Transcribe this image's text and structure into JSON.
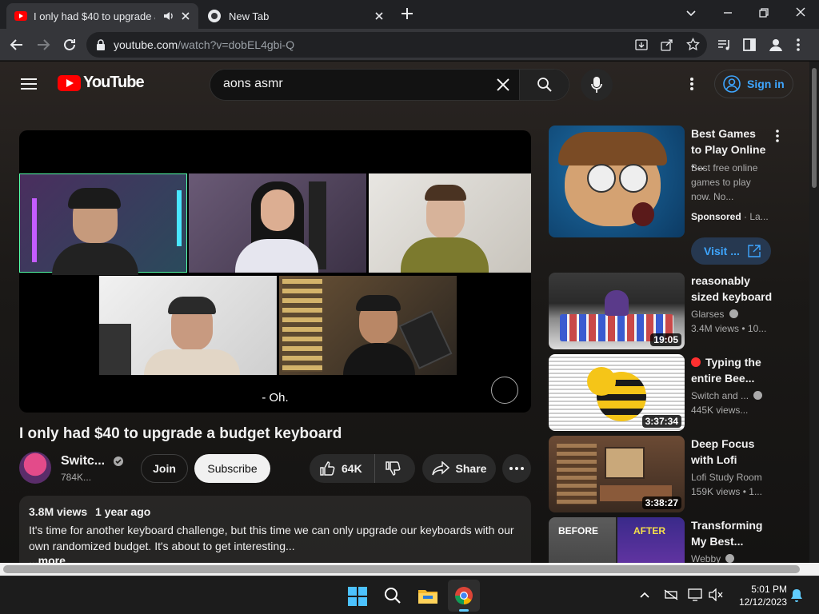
{
  "browser": {
    "tabs": [
      {
        "title": "I only had $40 to upgrade a",
        "active": true
      },
      {
        "title": "New Tab",
        "active": false
      }
    ],
    "url_host": "youtube.com",
    "url_path": "/watch?v=dobEL4gbi-Q"
  },
  "youtube": {
    "logo_text": "YouTube",
    "search_value": "aons asmr",
    "signin_label": "Sign in",
    "video": {
      "caption": "- Oh.",
      "title": "I only had $40 to upgrade a budget keyboard",
      "channel_name": "Switc...",
      "subscribers": "784K...",
      "join_label": "Join",
      "subscribe_label": "Subscribe",
      "likes": "64K",
      "share_label": "Share"
    },
    "description": {
      "views": "3.8M views",
      "age": "1 year ago",
      "text_line1": "It's time for another keyboard challenge, but this time we can only upgrade our keyboards with our",
      "text_line2": "own randomized budget. It's about to get interesting...",
      "more_label": "...more"
    },
    "sidebar": [
      {
        "title": "Best Games to Play Online -...",
        "meta1": "Best free online games to play now. No...",
        "sponsored": "Sponsored",
        "advertiser": "La...",
        "visit_label": "Visit ..."
      },
      {
        "title": "reasonably sized keyboard",
        "channel": "Glarses",
        "meta": "3.4M views",
        "age": "10...",
        "duration": "19:05"
      },
      {
        "title": "Typing the entire Bee...",
        "channel": "Switch and ...",
        "meta": "445K views...",
        "duration": "3:37:34"
      },
      {
        "title": "Deep Focus with Lofi",
        "channel": "Lofi Study Room",
        "meta": "159K views",
        "age": "1...",
        "duration": "3:38:27"
      },
      {
        "title": "Transforming My Best...",
        "channel": "Webby",
        "before_label": "BEFORE",
        "after_label": "AFTER"
      }
    ]
  },
  "taskbar": {
    "time": "5:01 PM",
    "date": "12/12/2023"
  },
  "colors": {
    "yt_red": "#ff0000",
    "link_blue": "#3ea6ff",
    "chrome_dark": "#202124"
  }
}
